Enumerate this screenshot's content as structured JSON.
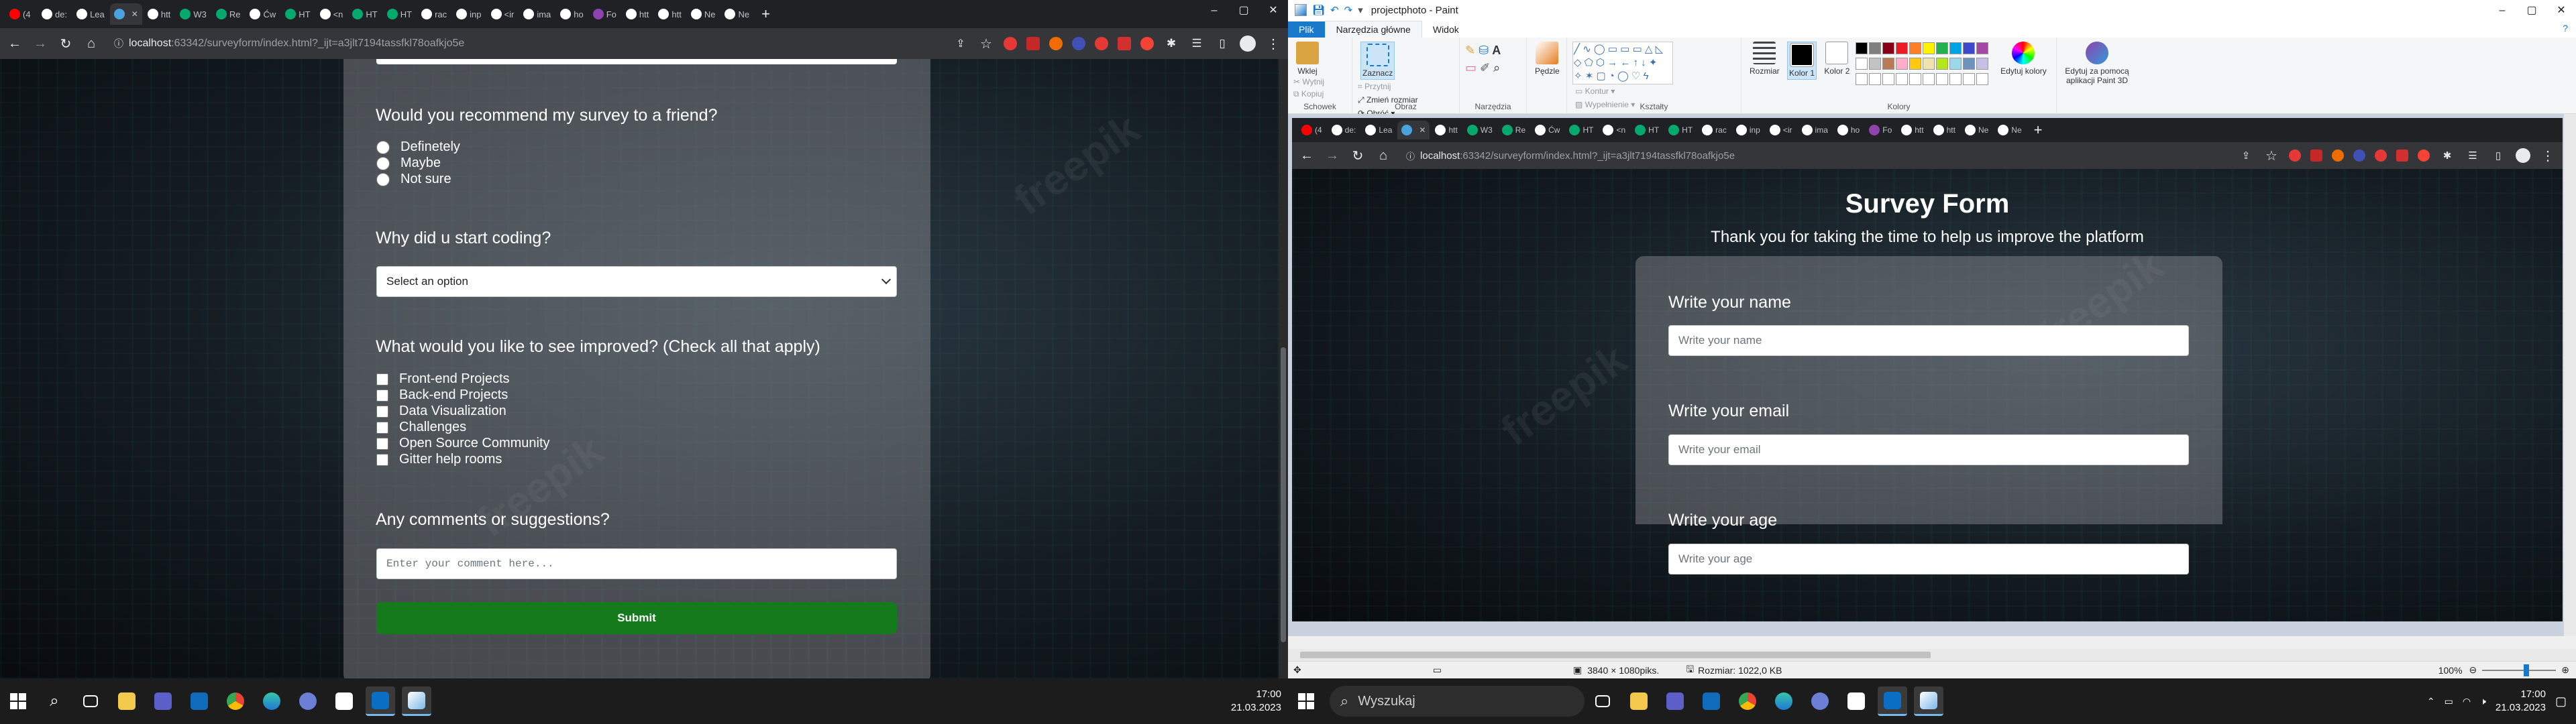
{
  "left": {
    "tabs": [
      {
        "label": "(4",
        "color": "#ff0000"
      },
      {
        "label": "de:",
        "color": "#ffffff"
      },
      {
        "label": "Lea",
        "color": "#ffffff"
      },
      {
        "label": "",
        "color": "#4aa3df",
        "active": true
      },
      {
        "label": "htt",
        "color": "#ffffff"
      },
      {
        "label": "W3",
        "color": "#04aa6d"
      },
      {
        "label": "Re",
        "color": "#04aa6d"
      },
      {
        "label": "Ćw",
        "color": "#ffffff"
      },
      {
        "label": "HT",
        "color": "#04aa6d"
      },
      {
        "label": "<n",
        "color": "#ffffff"
      },
      {
        "label": "HT",
        "color": "#04aa6d"
      },
      {
        "label": "HT",
        "color": "#04aa6d"
      },
      {
        "label": "rac",
        "color": "#ffffff"
      },
      {
        "label": "inp",
        "color": "#ffffff"
      },
      {
        "label": "<ir",
        "color": "#ffffff"
      },
      {
        "label": "ima",
        "color": "#ffffff"
      },
      {
        "label": "ho",
        "color": "#ffffff"
      },
      {
        "label": "Fo",
        "color": "#8e44ad"
      },
      {
        "label": "htt",
        "color": "#ffffff"
      },
      {
        "label": "htt",
        "color": "#ffffff"
      },
      {
        "label": "Ne",
        "color": "#ffffff"
      },
      {
        "label": "Ne",
        "color": "#ffffff"
      }
    ],
    "url_host": "localhost",
    "url_rest": ":63342/surveyform/index.html?_ijt=a3jlt7194tassfkl78oafkjo5e",
    "form": {
      "recommend_question": "Would you recommend my survey to a friend?",
      "recommend_options": [
        "Definetely",
        "Maybe",
        "Not sure"
      ],
      "why_question": "Why did u start coding?",
      "why_select_value": "Select an option",
      "improve_question": "What would you like to see improved? (Check all that apply)",
      "improve_options": [
        "Front-end Projects",
        "Back-end Projects",
        "Data Visualization",
        "Challenges",
        "Open Source Community",
        "Gitter help rooms"
      ],
      "comments_question": "Any comments or suggestions?",
      "comments_placeholder": "Enter your comment here...",
      "submit_label": "Submit"
    },
    "taskbar": {
      "search_placeholder": "",
      "clock_time": "17:00",
      "clock_date": "21.03.2023"
    }
  },
  "right": {
    "paint": {
      "title": "projectphoto - Paint",
      "menu_file": "Plik",
      "menu_home": "Narzędzia główne",
      "menu_view": "Widok",
      "groups": {
        "clipboard": "Schowek",
        "image": "Obraz",
        "tools": "Narzędzia",
        "shapes": "Kształty",
        "colors": "Kolory"
      },
      "buttons": {
        "paste": "Wklej",
        "cut": "Wytnij",
        "copy": "Kopiuj",
        "select": "Zaznacz",
        "crop": "Przytnij",
        "resize": "Zmień rozmiar",
        "rotate": "Obróć",
        "brushes": "Pędzle",
        "outline": "Kontur",
        "fill": "Wypełnienie",
        "size": "Rozmiar",
        "color1": "Kolor 1",
        "color2": "Kolor 2",
        "edit_colors": "Edytuj kolory",
        "paint3d": "Edytuj za pomocą aplikacji Paint 3D"
      },
      "palette": [
        "#000000",
        "#7f7f7f",
        "#880015",
        "#ed1c24",
        "#ff7f27",
        "#fff200",
        "#22b14c",
        "#00a2e8",
        "#3f48cc",
        "#a349a4",
        "#ffffff",
        "#c3c3c3",
        "#b97a57",
        "#ffaec9",
        "#ffc90e",
        "#efe4b0",
        "#b5e61d",
        "#99d9ea",
        "#7092be",
        "#c8bfe7"
      ],
      "status_size": "3840 × 1080piks.",
      "status_file": "Rozmiar: 1022,0 KB",
      "zoom": "100%"
    },
    "inner": {
      "url_host": "localhost",
      "url_rest": ":63342/surveyform/index.html?_ijt=a3jlt7194tassfkl78oafkjo5e",
      "title": "Survey Form",
      "subtitle": "Thank you for taking the time to help us improve the platform",
      "name_label": "Write your name",
      "name_placeholder": "Write your name",
      "email_label": "Write your email",
      "email_placeholder": "Write your email",
      "age_label": "Write your age",
      "age_placeholder": "Write your age"
    },
    "taskbar": {
      "search_placeholder": "Wyszukaj",
      "clock_time": "17:00",
      "clock_date": "21.03.2023"
    }
  }
}
